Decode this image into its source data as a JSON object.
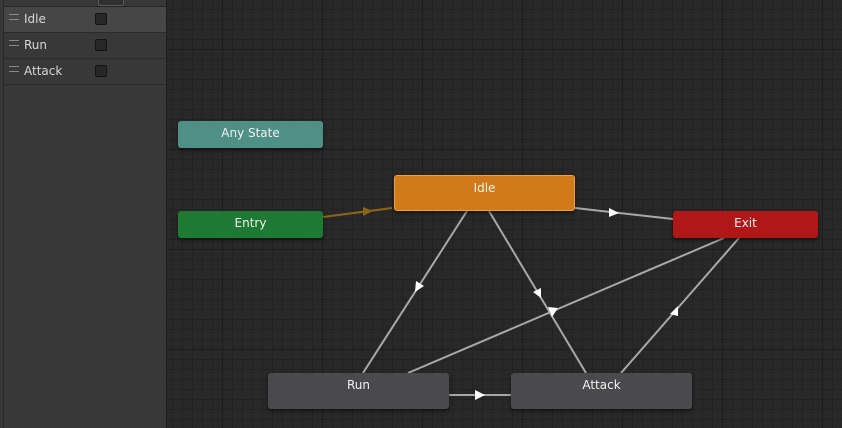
{
  "parameters": [
    {
      "name": "Idle",
      "selected": true
    },
    {
      "name": "Run",
      "selected": false
    },
    {
      "name": "Attack",
      "selected": false
    }
  ],
  "states": {
    "any_state": {
      "label": "Any State",
      "color": "#4e8f86"
    },
    "entry": {
      "label": "Entry",
      "color": "#1e7a32"
    },
    "idle": {
      "label": "Idle",
      "color": "#d07a1a"
    },
    "exit": {
      "label": "Exit",
      "color": "#b01818"
    },
    "run": {
      "label": "Run",
      "color": "#4a4a4c"
    },
    "attack": {
      "label": "Attack",
      "color": "#4a4a4c"
    }
  },
  "colors": {
    "transition": "#a8a8a8",
    "entry_transition": "#8a6418"
  }
}
